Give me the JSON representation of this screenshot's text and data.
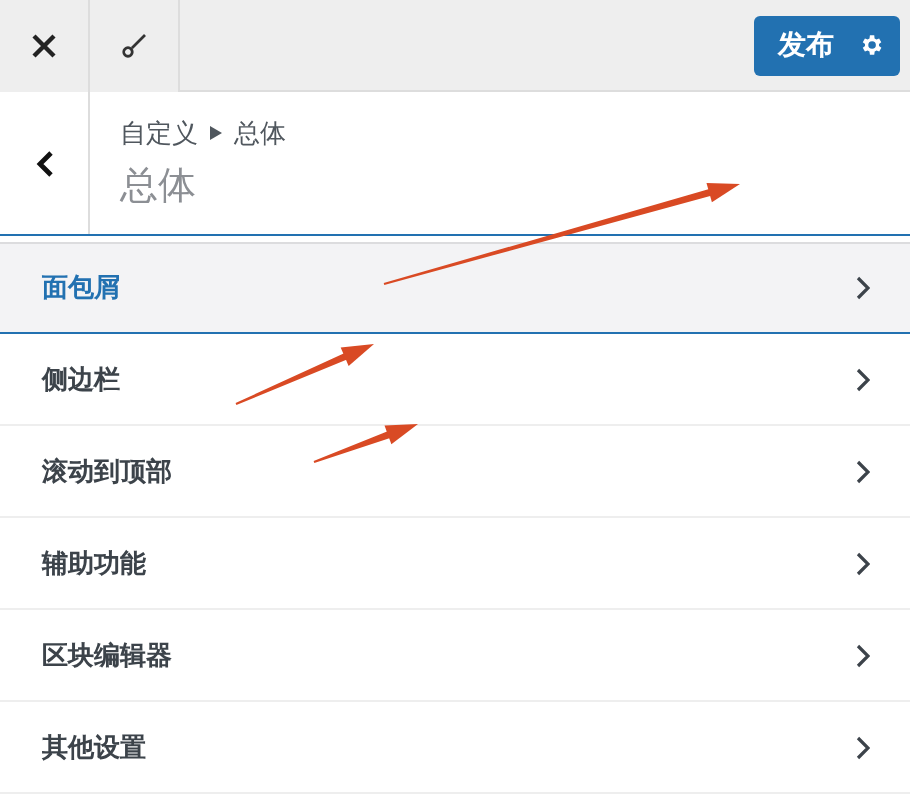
{
  "toolbar": {
    "publish_button": "发布"
  },
  "header": {
    "breadcrumb": [
      "自定义",
      "总体"
    ],
    "title": "总体"
  },
  "sections": [
    {
      "label": "面包屑",
      "selected": true
    },
    {
      "label": "侧边栏",
      "selected": false
    },
    {
      "label": "滚动到顶部",
      "selected": false
    },
    {
      "label": "辅助功能",
      "selected": false
    },
    {
      "label": "区块编辑器",
      "selected": false
    },
    {
      "label": "其他设置",
      "selected": false
    }
  ]
}
